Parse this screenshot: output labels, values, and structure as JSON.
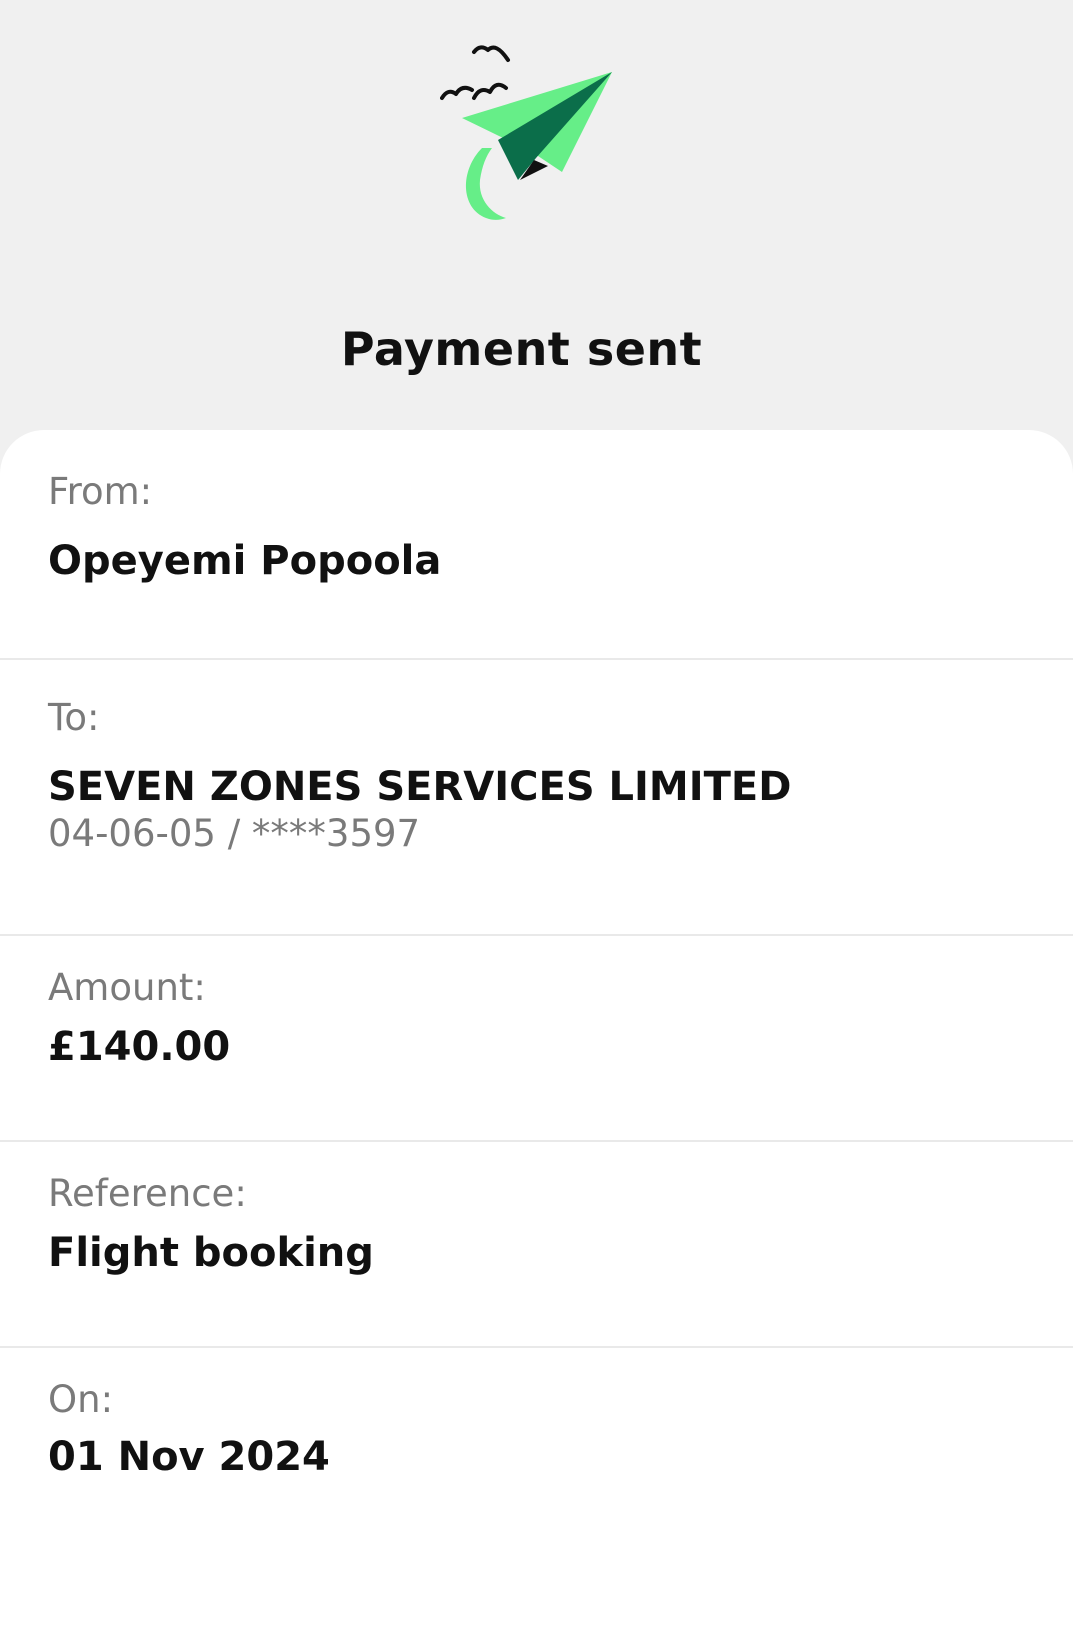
{
  "header": {
    "title": "Payment sent",
    "icon": "paper-plane-icon"
  },
  "colors": {
    "page_background": "#f0f0f0",
    "card_background": "#ffffff",
    "plane_light_green": "#66ee88",
    "plane_dark_green": "#0b6e4a",
    "label_gray": "#7a7a7a",
    "value_black": "#111111"
  },
  "details": {
    "from": {
      "label": "From:",
      "value": "Opeyemi Popoola"
    },
    "to": {
      "label": "To:",
      "value": "SEVEN ZONES SERVICES LIMITED",
      "account": "04-06-05 / ****3597"
    },
    "amount": {
      "label": "Amount:",
      "value": "£140.00"
    },
    "reference": {
      "label": "Reference:",
      "value": "Flight booking"
    },
    "on": {
      "label": "On:",
      "value": "01 Nov 2024"
    }
  }
}
